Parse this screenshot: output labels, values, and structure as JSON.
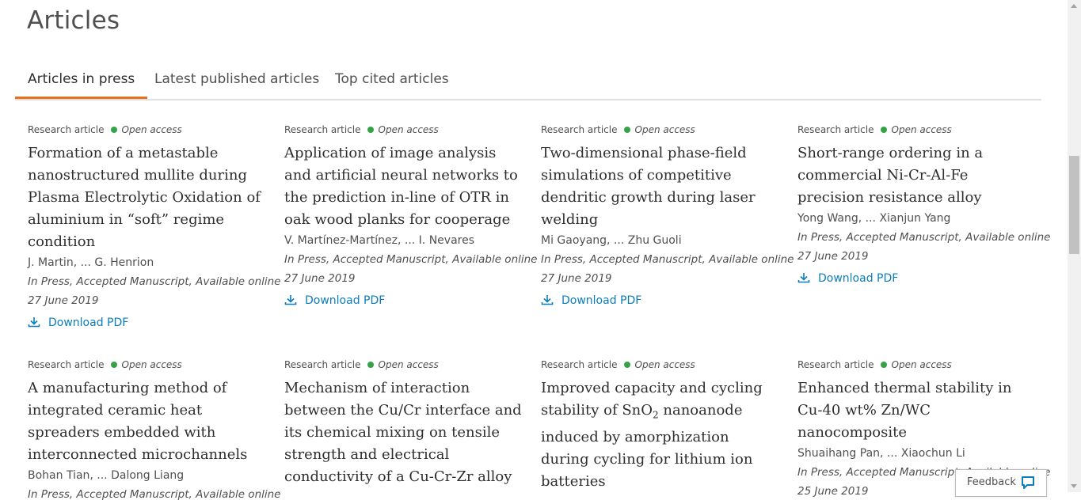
{
  "page": {
    "title": "Articles"
  },
  "tabs": [
    {
      "label": "Articles in press",
      "active": true
    },
    {
      "label": "Latest published articles",
      "active": false
    },
    {
      "label": "Top cited articles",
      "active": false
    }
  ],
  "colors": {
    "accent": "#e9711c",
    "open_access_dot": "#35a345",
    "link": "#0c7dbb"
  },
  "articles": [
    {
      "type": "Research article",
      "access": "Open access",
      "title": "Formation of a metastable nanostructured mullite during Plasma Electrolytic Oxidation of aluminium in “soft” regime condition",
      "authors": "J. Martin, ... G. Henrion",
      "status": "In Press, Accepted Manuscript, Available online",
      "date": "27 June 2019",
      "download": "Download PDF",
      "icon": "download-icon"
    },
    {
      "type": "Research article",
      "access": "Open access",
      "title": "Application of image analysis and artificial neural networks to the prediction in-line of OTR in oak wood planks for cooperage",
      "authors": "V. Martínez-Martínez, ... I. Nevares",
      "status": "In Press, Accepted Manuscript, Available online",
      "date": "27 June 2019",
      "download": "Download PDF",
      "icon": "download-icon"
    },
    {
      "type": "Research article",
      "access": "Open access",
      "title": "Two-dimensional phase-field simulations of competitive dendritic growth during laser welding",
      "authors": "Mi Gaoyang, ... Zhu Guoli",
      "status": "In Press, Accepted Manuscript, Available online",
      "date": "27 June 2019",
      "download": "Download PDF",
      "icon": "download-icon"
    },
    {
      "type": "Research article",
      "access": "Open access",
      "title": "Short-range ordering in a commercial Ni-Cr-Al-Fe precision resistance alloy",
      "authors": "Yong Wang, ... Xianjun Yang",
      "status": "In Press, Accepted Manuscript, Available online",
      "date": "27 June 2019",
      "download": "Download PDF",
      "icon": "download-icon"
    },
    {
      "type": "Research article",
      "access": "Open access",
      "title": "A manufacturing method of integrated ceramic heat spreaders embedded with interconnected microchannels",
      "authors": "Bohan Tian, ... Dalong Liang",
      "status": "In Press, Accepted Manuscript, Available online"
    },
    {
      "type": "Research article",
      "access": "Open access",
      "title": "Mechanism of interaction between the Cu/Cr interface and its chemical mixing on tensile strength and electrical conductivity of a Cu-Cr-Zr alloy"
    },
    {
      "type": "Research article",
      "access": "Open access",
      "title_parts": [
        "Improved capacity and cycling stability of SnO",
        "2",
        " nanoanode induced by amorphization during cycling for lithium ion batteries"
      ]
    },
    {
      "type": "Research article",
      "access": "Open access",
      "title": "Enhanced thermal stability in Cu-40 wt% Zn/WC nanocomposite",
      "authors": "Shuaihang Pan, ... Xiaochun Li",
      "status": "In Press, Accepted Manuscript, Available online",
      "date": "25 June 2019"
    }
  ],
  "feedback": {
    "label": "Feedback",
    "icon": "chat-bubble-icon"
  }
}
